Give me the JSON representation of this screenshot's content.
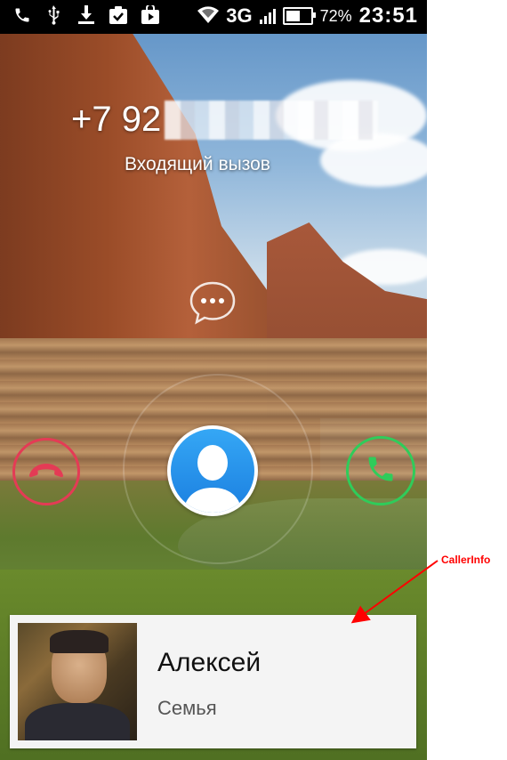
{
  "status_bar": {
    "network": "3G",
    "battery_percent": "72%",
    "battery_level": 0.72,
    "time": "23:51",
    "icons": [
      "phone-icon",
      "usb-icon",
      "download-icon",
      "clipboard-check-icon",
      "play-store-icon",
      "wifi-icon",
      "signal-icon",
      "battery-icon"
    ]
  },
  "call": {
    "number": "+7 92",
    "status": "Входящий вызов"
  },
  "buttons": {
    "message": "message-icon",
    "decline": "decline-call-icon",
    "accept": "accept-call-icon",
    "avatar": "contact-avatar-icon",
    "decline_color": "#e43b55",
    "accept_color": "#2fcc5a",
    "avatar_color": "#1b8ef0"
  },
  "caller_info": {
    "name": "Алексей",
    "group": "Семья"
  },
  "annotation": {
    "label": "CallerInfo",
    "color": "#ff0000"
  }
}
